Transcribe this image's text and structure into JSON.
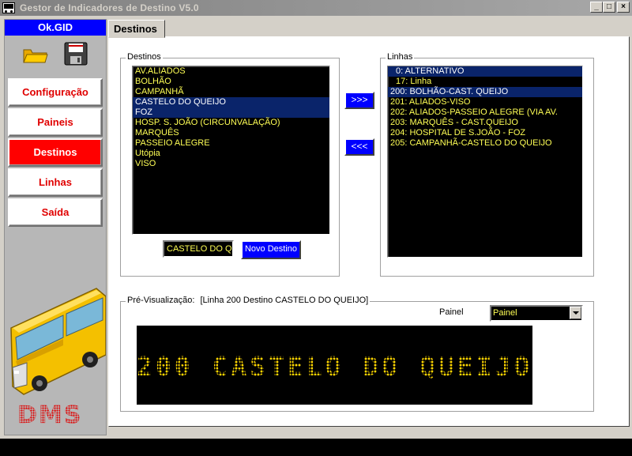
{
  "window": {
    "title": "Gestor de Indicadores de Destino  V5.0",
    "minimize": "_",
    "maximize": "□",
    "close": "×"
  },
  "sidebar": {
    "header": "Ok.GID",
    "items": [
      {
        "label": "Configuração"
      },
      {
        "label": "Paineis"
      },
      {
        "label": "Destinos",
        "active": true
      },
      {
        "label": "Linhas"
      },
      {
        "label": "Saída"
      }
    ],
    "logo": "DMS"
  },
  "tab": {
    "label": "Destinos"
  },
  "destinos": {
    "group_label": "Destinos",
    "items": [
      "AV.ALIADOS",
      "BOLHÃO",
      "CAMPANHÃ",
      "CASTELO DO QUEIJO",
      "FOZ",
      "HOSP. S. JOÃO (CIRCUNVALAÇÃO)",
      "MARQUÊS",
      "PASSEIO ALEGRE",
      "Utópia",
      "VISO"
    ],
    "selected": [
      3,
      4
    ],
    "field_value": "CASTELO DO QU",
    "novo_label": "Novo Destino"
  },
  "arrows": {
    "add": ">>>",
    "remove": "<<<"
  },
  "linhas": {
    "group_label": "Linhas",
    "items": [
      "0: ALTERNATIVO",
      "17: Linha",
      "200: BOLHÃO-CAST. QUEIJO",
      "201: ALIADOS-VISO",
      "202: ALIADOS-PASSEIO ALEGRE (VIA AV.",
      "203: MARQUÊS - CAST.QUEIJO",
      "204: HOSPITAL DE S.JOÃO - FOZ",
      "205: CAMPANHÃ-CASTELO DO QUEIJO"
    ],
    "selected": [
      0,
      2
    ]
  },
  "preview": {
    "label": "Pré-Visualização:",
    "info": "[Linha 200  Destino CASTELO DO QUEIJO]",
    "painel_label": "Painel",
    "painel_value": "Painel",
    "led_text": "200 CASTELO DO QUEIJO"
  },
  "colors": {
    "accent_blue": "#0000ff",
    "active_red": "#ff0000",
    "led_yellow": "#ffd700",
    "list_text": "#ffff55",
    "selection": "#0a246a"
  }
}
